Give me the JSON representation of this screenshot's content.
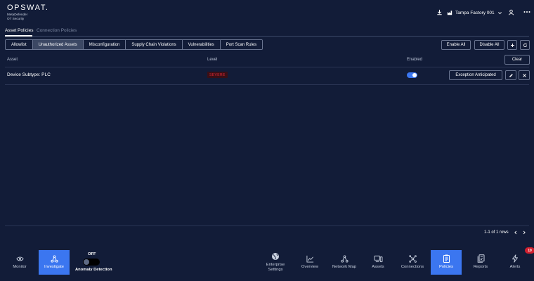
{
  "header": {
    "logo_word": "OPSWAT.",
    "logo_line1": "MetaDefender",
    "logo_line2": "OT Security",
    "site_name": "Tampa Factory 001",
    "icons": [
      "download-icon",
      "factory-icon",
      "chevron-down-icon",
      "user-icon",
      "more-icon"
    ]
  },
  "tabs": [
    {
      "label": "Asset Policies",
      "active": true
    },
    {
      "label": "Connection Policies",
      "active": false
    }
  ],
  "segments": [
    {
      "label": "Allowlist",
      "active": false
    },
    {
      "label": "Unauthorized Assets",
      "active": true
    },
    {
      "label": "Misconfiguration",
      "active": false
    },
    {
      "label": "Supply Chain Violations",
      "active": false
    },
    {
      "label": "Vulnerabilities",
      "active": false
    },
    {
      "label": "Port Scan Rules",
      "active": false
    }
  ],
  "toolbar": {
    "enable_all": "Enable All",
    "disable_all": "Disable All",
    "add_icon": "plus-icon",
    "refresh_icon": "refresh-icon"
  },
  "table": {
    "columns": {
      "asset": "Asset",
      "level": "Level",
      "enabled": "Enabled"
    },
    "clear_label": "Clear",
    "rows": [
      {
        "asset": "Device Subtype: PLC",
        "level": "SEVERE",
        "enabled": true,
        "action": "Exception Anticipated"
      }
    ]
  },
  "pagination": {
    "summary": "1-1 of 1 rows"
  },
  "bottom_nav": {
    "items": [
      {
        "label": "Monitor",
        "icon": "eye-icon",
        "active": false
      },
      {
        "label": "Investigate",
        "icon": "network-nodes-icon",
        "active": true
      },
      {
        "label": "Enterprise Settings",
        "icon": "globe-icon",
        "active": false
      },
      {
        "label": "Overview",
        "icon": "line-chart-icon",
        "active": false
      },
      {
        "label": "Network Map",
        "icon": "network-map-icon",
        "active": false
      },
      {
        "label": "Assets",
        "icon": "devices-icon",
        "active": false
      },
      {
        "label": "Connections",
        "icon": "connections-icon",
        "active": false
      },
      {
        "label": "Policies",
        "icon": "clipboard-icon",
        "active": true
      },
      {
        "label": "Reports",
        "icon": "reports-icon",
        "active": false
      },
      {
        "label": "Alerts",
        "icon": "bolt-icon",
        "active": false
      }
    ],
    "anomaly": {
      "state": "OFF",
      "label": "Anomaly Detection",
      "enabled": false
    },
    "alert_count": "19"
  },
  "colors": {
    "background": "#121c38",
    "accent": "#3b76f0",
    "severe": "#e02a36",
    "border": "#6a7591"
  }
}
